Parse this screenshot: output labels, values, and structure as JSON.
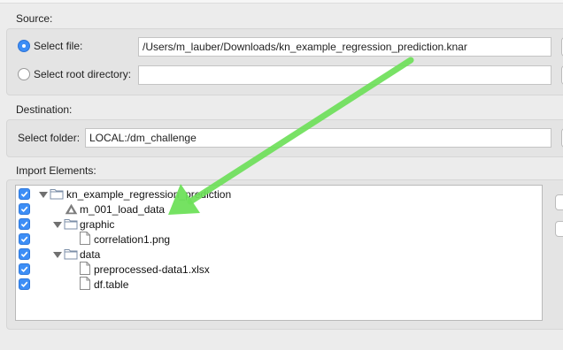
{
  "source": {
    "section_label": "Source:",
    "select_file_label": "Select file:",
    "file_path": "/Users/m_lauber/Downloads/kn_example_regression_prediction.knar",
    "select_root_label": "Select root directory:",
    "root_path": ""
  },
  "destination": {
    "section_label": "Destination:",
    "folder_label": "Select folder:",
    "folder_value": "LOCAL:/dm_challenge"
  },
  "import": {
    "section_label": "Import Elements:",
    "tree": [
      {
        "label": "kn_example_regression_prediction",
        "icon": "folder-icon",
        "checked": true
      },
      {
        "label": "m_001_load_data",
        "icon": "workflow-icon",
        "checked": true
      },
      {
        "label": "graphic",
        "icon": "folder-icon",
        "checked": true
      },
      {
        "label": "correlation1.png",
        "icon": "file-icon",
        "checked": true
      },
      {
        "label": "data",
        "icon": "folder-icon",
        "checked": true
      },
      {
        "label": "preprocessed-data1.xlsx",
        "icon": "file-icon",
        "checked": true
      },
      {
        "label": "df.table",
        "icon": "file-icon",
        "checked": true
      }
    ]
  },
  "colors": {
    "accent": "#3d8ef6",
    "arrow": "#6ee05a"
  }
}
